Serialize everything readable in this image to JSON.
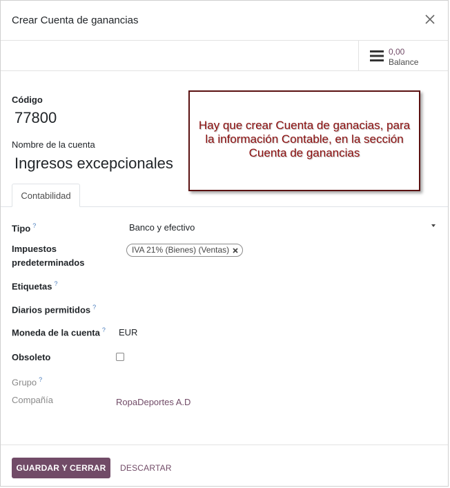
{
  "dialog": {
    "title": "Crear Cuenta de ganancias"
  },
  "stat_button": {
    "value": "0,00",
    "label": "Balance",
    "icon": "bars-icon"
  },
  "form": {
    "code_label": "Código",
    "code_value": "77800",
    "name_label": "Nombre de la cuenta",
    "name_value": "Ingresos excepcionales"
  },
  "note": {
    "text": "Hay que crear Cuenta de ganacias, para la información Contable, en la sección Cuenta de ganancias"
  },
  "tabs": [
    {
      "label": "Contabilidad",
      "active": true
    }
  ],
  "fields": {
    "tipo": {
      "label": "Tipo",
      "value": "Banco y efectivo",
      "help": "?"
    },
    "impuestos": {
      "label": "Impuestos predeterminados",
      "tag": "IVA 21% (Bienes) (Ventas)"
    },
    "etiquetas": {
      "label": "Etiquetas",
      "help": "?"
    },
    "diarios": {
      "label": "Diarios permitidos",
      "help": "?"
    },
    "moneda": {
      "label": "Moneda de la cuenta",
      "value": "EUR",
      "help": "?"
    },
    "obsoleto": {
      "label": "Obsoleto",
      "checked": false
    },
    "grupo": {
      "label": "Grupo",
      "help": "?"
    },
    "compania": {
      "label": "Compañía",
      "value": "RopaDeportes A.D"
    }
  },
  "footer": {
    "save_label": "GUARDAR Y CERRAR",
    "discard_label": "DESCARTAR"
  },
  "colors": {
    "primary": "#714B67",
    "note_text": "#8b0f0f",
    "note_border": "#5a1010"
  }
}
